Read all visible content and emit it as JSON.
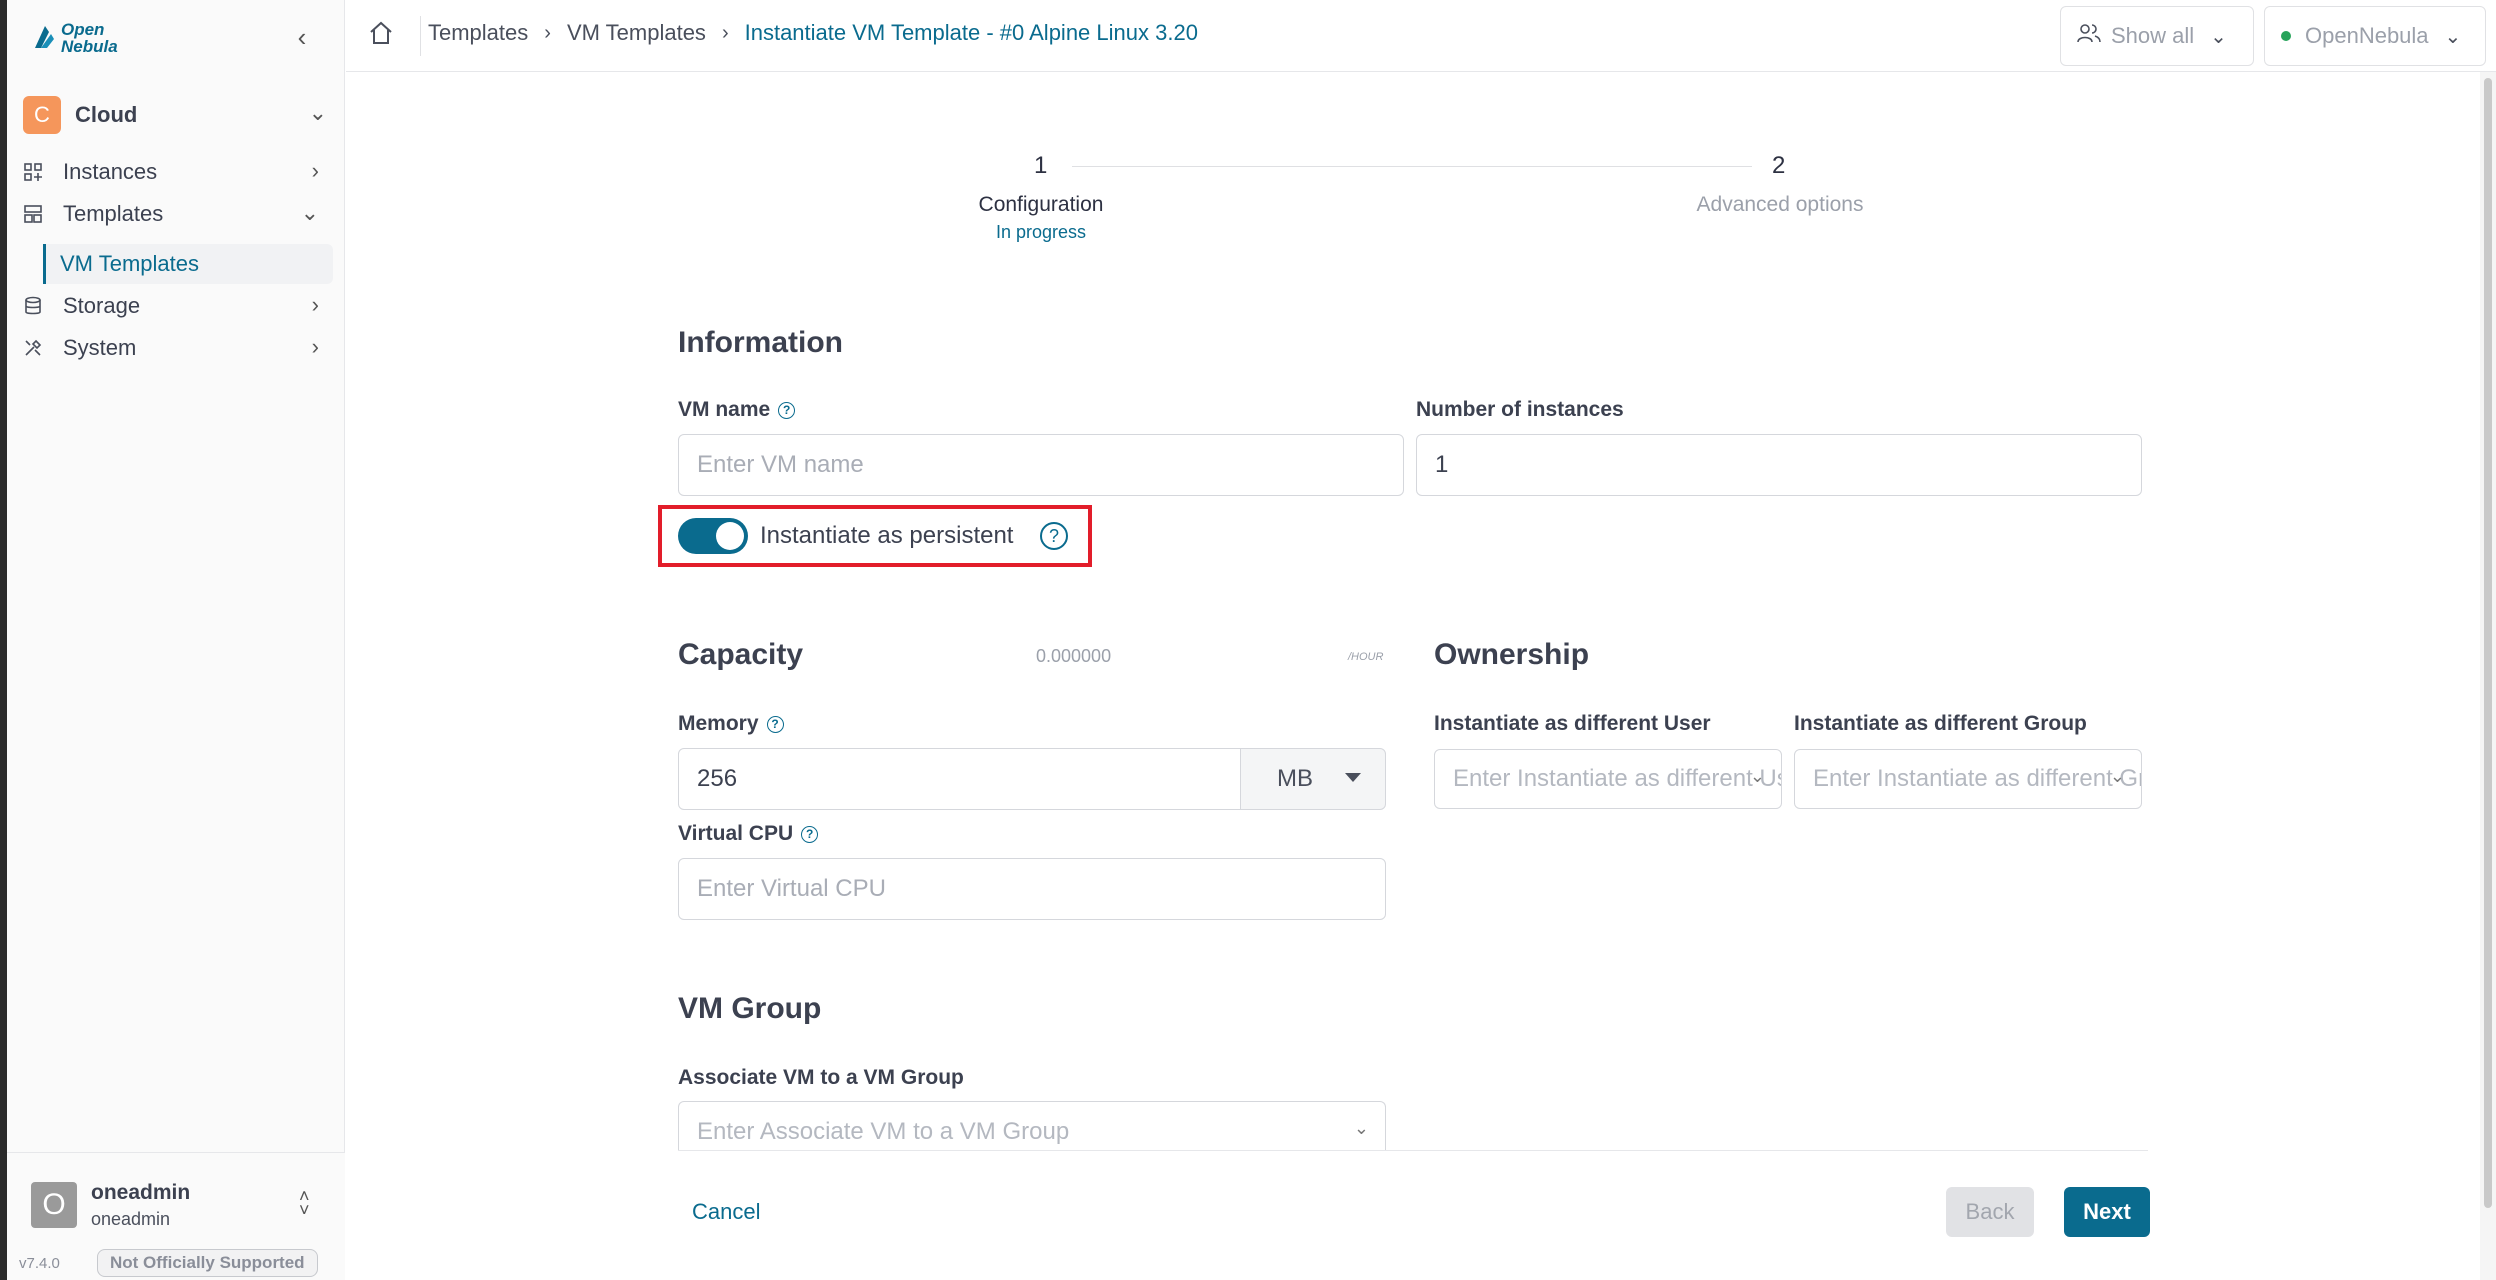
{
  "app": {
    "logo_line1": "Open",
    "logo_line2": "Nebula"
  },
  "sidebar": {
    "group": {
      "initial": "C",
      "name": "Cloud"
    },
    "items": [
      {
        "label": "Instances"
      },
      {
        "label": "Templates"
      },
      {
        "label": "VM Templates"
      },
      {
        "label": "Storage"
      },
      {
        "label": "System"
      }
    ],
    "user": {
      "initial": "O",
      "name": "oneadmin",
      "group": "oneadmin"
    },
    "version": "v7.4.0",
    "support_badge": "Not Officially Supported"
  },
  "header": {
    "breadcrumbs": [
      "Templates",
      "VM Templates"
    ],
    "current": "Instantiate VM Template - #0 Alpine Linux 3.20",
    "filter_label": "Show all",
    "zone_label": "OpenNebula"
  },
  "stepper": {
    "steps": [
      {
        "number": "1",
        "title": "Configuration",
        "status": "In progress"
      },
      {
        "number": "2",
        "title": "Advanced options"
      }
    ]
  },
  "information": {
    "title": "Information",
    "vm_name_label": "VM name",
    "vm_name_placeholder": "Enter VM name",
    "instances_label": "Number of instances",
    "instances_value": "1",
    "persistent_label": "Instantiate as persistent",
    "persistent_on": true
  },
  "capacity": {
    "title": "Capacity",
    "cost": "0.000000",
    "cost_unit": "/HOUR",
    "memory_label": "Memory",
    "memory_value": "256",
    "memory_unit": "MB",
    "vcpu_label": "Virtual CPU",
    "vcpu_placeholder": "Enter Virtual CPU"
  },
  "ownership": {
    "title": "Ownership",
    "user_label": "Instantiate as different User",
    "user_placeholder": "Enter Instantiate as different User",
    "group_label": "Instantiate as different Group",
    "group_placeholder": "Enter Instantiate as different Group"
  },
  "vm_group": {
    "title": "VM Group",
    "label": "Associate VM to a VM Group",
    "placeholder": "Enter Associate VM to a VM Group"
  },
  "footer": {
    "cancel": "Cancel",
    "back": "Back",
    "next": "Next"
  },
  "colors": {
    "accent": "#0a6b8e",
    "highlight": "#e21d2a",
    "group_avatar": "#f5965b",
    "status_dot": "#27a35a"
  }
}
